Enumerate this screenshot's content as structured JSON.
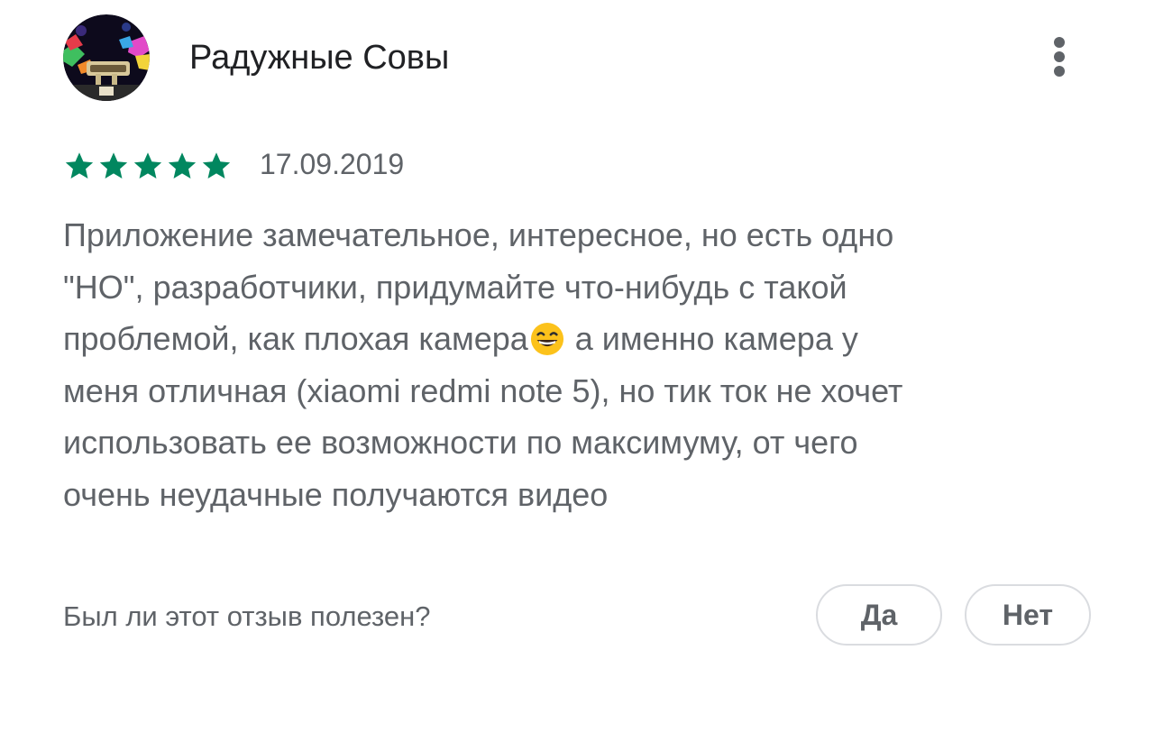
{
  "review": {
    "author": "Радужные Совы",
    "avatar_icon": "user-avatar-image",
    "menu_icon": "more-vert-icon",
    "rating": 5,
    "rating_max": 5,
    "star_color": "#01875f",
    "date": "17.09.2019",
    "text_before_emoji": "Приложение замечательное, интересное, но есть одно\n\"НО\", разработчики, придумайте что-нибудь с такой\nпроблемой, как плохая камера",
    "emoji": "grinning-face-with-smiling-eyes",
    "text_after_emoji": " а именно камера у\nменя отличная (xiaomi redmi note 5), но тик ток не хочет\nиспользовать ее возможности по максимуму, от чего\nочень неудачные получаются видео"
  },
  "helpful": {
    "question": "Был ли этот отзыв полезен?",
    "yes_label": "Да",
    "no_label": "Нет"
  }
}
